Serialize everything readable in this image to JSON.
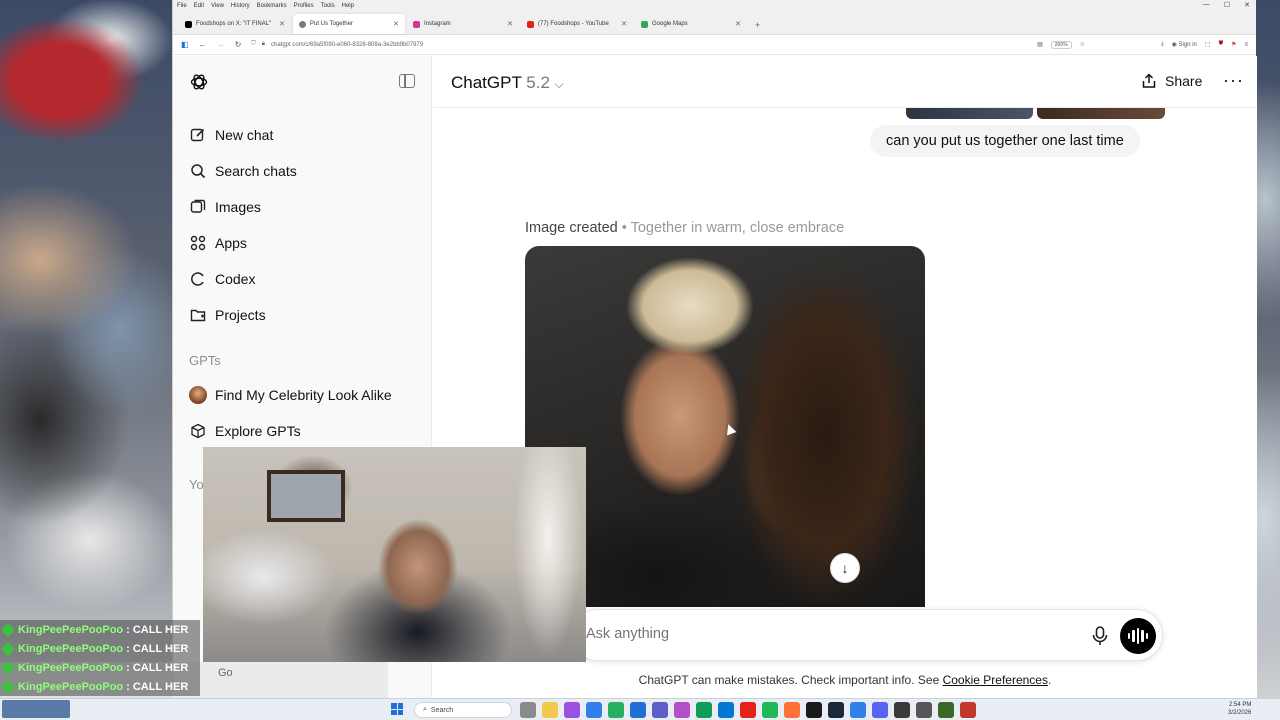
{
  "browser": {
    "menu": [
      "File",
      "Edit",
      "View",
      "History",
      "Bookmarks",
      "Profiles",
      "Tools",
      "Help"
    ],
    "tabs": [
      {
        "label": "Foodshops on X: \"IT FINAL\"",
        "color": "#000000"
      },
      {
        "label": "Put Us Together",
        "color": "#7a7a7a"
      },
      {
        "label": "Instagram",
        "color": "#d6338a"
      },
      {
        "label": "(77) Foodshops - YouTube",
        "color": "#e62117"
      },
      {
        "label": "Google Maps",
        "color": "#34a853"
      }
    ],
    "url": "chatgpt.com/c/69a5f090-e060-8328-809a-3e2bb9b07979",
    "zoom": "200%",
    "signin": "Sign in"
  },
  "sidebar": {
    "items": [
      {
        "label": "New chat",
        "icon": "edit-icon"
      },
      {
        "label": "Search chats",
        "icon": "search-icon"
      },
      {
        "label": "Images",
        "icon": "images-icon"
      },
      {
        "label": "Apps",
        "icon": "apps-icon"
      },
      {
        "label": "Codex",
        "icon": "codex-icon"
      },
      {
        "label": "Projects",
        "icon": "folder-icon"
      }
    ],
    "gpts_header": "GPTs",
    "gpts": [
      {
        "label": "Find My Celebrity Look Alike",
        "icon": "celebrity-avatar-icon"
      },
      {
        "label": "Explore GPTs",
        "icon": "cube-icon"
      }
    ],
    "partial_label": "Yo"
  },
  "header": {
    "model": "ChatGPT",
    "version": "5.2",
    "share": "Share"
  },
  "conversation": {
    "user_message": "can you put us together one last time",
    "image_caption_main": "Image created",
    "image_caption_sub": " • Together in warm, close embrace"
  },
  "composer": {
    "placeholder": "Ask anything"
  },
  "footer": {
    "disclaimer": "ChatGPT can make mistakes. Check important info. See ",
    "link": "Cookie Preferences",
    "end": "."
  },
  "stream_chat": {
    "lines": [
      {
        "user": "KingPeePeePooPoo",
        "msg": ": CALL HER"
      },
      {
        "user": "KingPeePeePooPoo",
        "msg": ": CALL HER"
      },
      {
        "user": "KingPeePeePooPoo",
        "msg": ": CALL HER"
      },
      {
        "user": "KingPeePeePooPoo",
        "msg": ": CALL HER"
      }
    ],
    "go": "Go"
  },
  "taskbar": {
    "search": "Search",
    "time": "2:54 PM",
    "date": "3/2/2026"
  }
}
